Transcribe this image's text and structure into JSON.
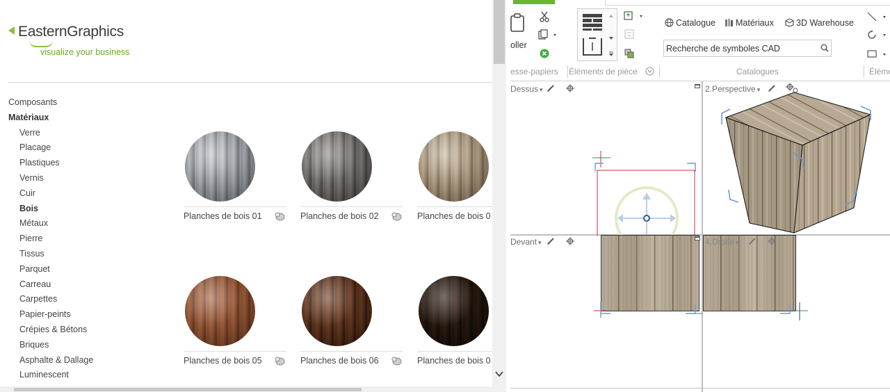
{
  "logo": {
    "name": "EasternGraphics",
    "tagline": "visualize your business",
    "colors": {
      "accent": "#8cbf3f",
      "text": "#3a3a3a"
    }
  },
  "categories": [
    {
      "label": "Composants",
      "level": "top",
      "active": false
    },
    {
      "label": "Matériaux",
      "level": "top",
      "active": true
    },
    {
      "label": "Verre",
      "level": "sub",
      "active": false
    },
    {
      "label": "Placage",
      "level": "sub",
      "active": false
    },
    {
      "label": "Plastiques",
      "level": "sub",
      "active": false
    },
    {
      "label": "Vernis",
      "level": "sub",
      "active": false
    },
    {
      "label": "Cuir",
      "level": "sub",
      "active": false
    },
    {
      "label": "Bois",
      "level": "sub",
      "active": true
    },
    {
      "label": "Métaux",
      "level": "sub",
      "active": false
    },
    {
      "label": "Pierre",
      "level": "sub",
      "active": false
    },
    {
      "label": "Tissus",
      "level": "sub",
      "active": false
    },
    {
      "label": "Parquet",
      "level": "sub",
      "active": false
    },
    {
      "label": "Carreau",
      "level": "sub",
      "active": false
    },
    {
      "label": "Carpettes",
      "level": "sub",
      "active": false
    },
    {
      "label": "Papier-peints",
      "level": "sub",
      "active": false
    },
    {
      "label": "Crépies & Bétons",
      "level": "sub",
      "active": false
    },
    {
      "label": "Briques",
      "level": "sub",
      "active": false
    },
    {
      "label": "Asphalte & Dallage",
      "level": "sub",
      "active": false
    },
    {
      "label": "Luminescent",
      "level": "sub",
      "active": false
    }
  ],
  "materials": [
    {
      "label": "Planches de bois 01",
      "colors": [
        "#e4e6e8",
        "#b8bcc0",
        "#8e9296"
      ]
    },
    {
      "label": "Planches de bois 02",
      "colors": [
        "#c8c6c4",
        "#9d9a97",
        "#6f6c69"
      ]
    },
    {
      "label": "Planches de bois 0",
      "colors": [
        "#e6ddd0",
        "#c7bba8",
        "#9c8f7c"
      ]
    },
    {
      "label": "Planches de bois 05",
      "colors": [
        "#d6ab8c",
        "#b68668",
        "#8d6247"
      ]
    },
    {
      "label": "Planches de bois 06",
      "colors": [
        "#b78e70",
        "#8c6448",
        "#5c3e2a"
      ]
    },
    {
      "label": "Planches de bois 0",
      "colors": [
        "#7a6450",
        "#54412f",
        "#33261b"
      ]
    }
  ],
  "ribbon": {
    "paste_label": "oller",
    "groups": {
      "clipboard": "esse-papiers",
      "room_elements": "Éléments de pièce",
      "catalogues": "Catalogues",
      "next": "Éléme"
    },
    "catalogue_buttons": {
      "catalogue": "Catalogue",
      "materials": "Matériaux",
      "warehouse": "3D Warehouse"
    },
    "cad_search": {
      "placeholder": "Recherche de symboles CAD",
      "value": ""
    }
  },
  "viewports": {
    "top": "Dessus",
    "perspective": "2.Perspective",
    "front": "Devant",
    "right": "4.Droite"
  },
  "colors": {
    "brand_green": "#6ab531",
    "selection_blue": "#6f96d6",
    "selection_red": "#c8323c",
    "wood_base": "#b3a58f"
  }
}
